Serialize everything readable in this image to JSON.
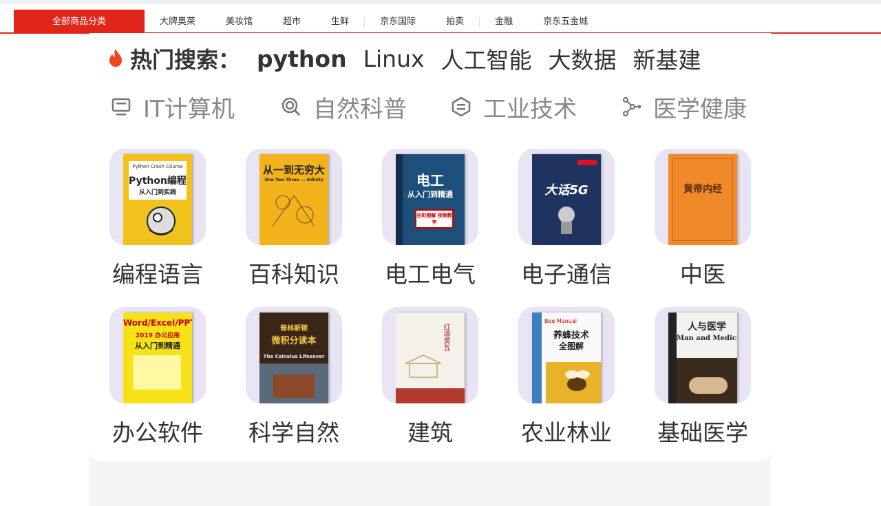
{
  "nav": {
    "category": "全部商品分类",
    "items": [
      "大牌奥莱",
      "美妆馆",
      "超市",
      "生鲜",
      "京东国际",
      "拍卖",
      "金融",
      "京东五金城"
    ]
  },
  "hot_search": {
    "label": "热门搜索：",
    "terms": [
      "python",
      "Linux",
      "人工智能",
      "大数据",
      "新基建"
    ]
  },
  "categories": [
    {
      "label": "IT计算机",
      "icon": "monitor-icon"
    },
    {
      "label": "自然科普",
      "icon": "magnifier-icon"
    },
    {
      "label": "工业技术",
      "icon": "hexagon-icon"
    },
    {
      "label": "医学健康",
      "icon": "molecule-icon"
    }
  ],
  "tiles": [
    {
      "caption": "编程语言",
      "book_title": "Python编程",
      "book_sub": "从入门到实践",
      "top_text": "Python Crash Course",
      "cover": "#f1c21b",
      "ink": "#222"
    },
    {
      "caption": "百科知识",
      "book_title": "从一到无穷大",
      "book_sub": "One Two Three ... Infinity",
      "cover": "#f2b31d",
      "ink": "#222"
    },
    {
      "caption": "电工电气",
      "book_title": "电工",
      "book_sub": "从入门到精通",
      "top_text": "全彩图解 视频教学",
      "cover": "#1d4f7a",
      "ink": "#fff"
    },
    {
      "caption": "电子通信",
      "book_title": "大话5G",
      "book_sub": "",
      "cover": "#1e3360",
      "ink": "#fff"
    },
    {
      "caption": "中医",
      "book_title": "黄帝内经",
      "book_sub": "",
      "cover": "#f0892a",
      "ink": "#5a2a00"
    },
    {
      "caption": "办公软件",
      "book_title": "Word/Excel/PPT",
      "book_sub": "从入门到精通",
      "top_text": "2019 办公应用",
      "cover": "#f7e21a",
      "ink": "#c7000b"
    },
    {
      "caption": "科学自然",
      "book_title": "微积分读本",
      "book_sub": "The Calculus Lifesaver",
      "top_text": "普林斯顿",
      "cover": "#3a2616",
      "ink": "#f3c645"
    },
    {
      "caption": "建筑",
      "book_title": "红墙黄瓦",
      "book_sub": "",
      "cover": "#f4f1ea",
      "ink": "#a33"
    },
    {
      "caption": "农业林业",
      "book_title": "养蜂技术",
      "book_sub": "全图解",
      "top_text": "Bee Manual",
      "cover": "#fafafa",
      "ink": "#222"
    },
    {
      "caption": "基础医学",
      "book_title": "人与医学",
      "book_sub": "Man and Medicine",
      "cover": "#f4f2ee",
      "ink": "#222"
    }
  ]
}
